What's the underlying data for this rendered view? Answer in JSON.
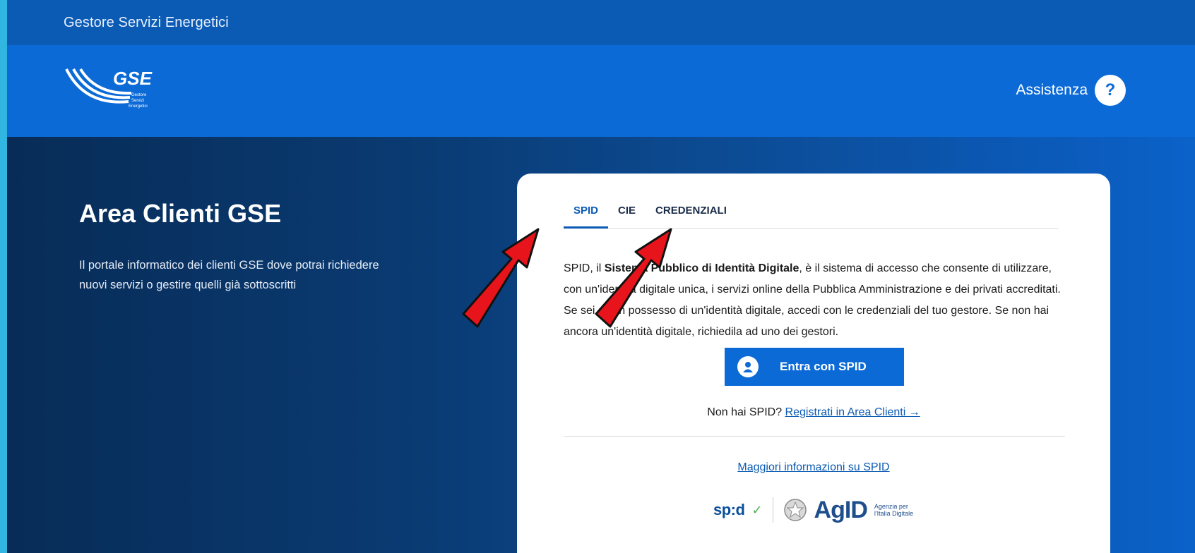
{
  "topbar": {
    "org_name": "Gestore Servizi Energetici"
  },
  "header": {
    "logo": {
      "wordmark": "GSE",
      "subtitle_1": "Gestore",
      "subtitle_2": "Servizi",
      "subtitle_3": "Energetici"
    },
    "assist_label": "Assistenza",
    "help_icon": "question-icon",
    "help_glyph": "?"
  },
  "hero": {
    "title": "Area Clienti GSE",
    "text": "Il portale informatico dei clienti GSE dove potrai richiedere nuovi servizi o gestire quelli già sottoscritti"
  },
  "login": {
    "tabs": [
      {
        "label": "SPID",
        "active": true
      },
      {
        "label": "CIE",
        "active": false
      },
      {
        "label": "CREDENZIALI",
        "active": false
      }
    ],
    "desc_1": "SPID, il ",
    "desc_bold": "Sistema Pubblico di Identità Digitale",
    "desc_2": ", è il sistema di accesso che consente di utilizzare, con un'identità digitale unica, i servizi online della Pubblica Amministrazione e dei privati accreditati. Se sei già in possesso di un'identità digitale, accedi con le credenziali del tuo gestore. Se non hai ancora un'identità digitale, richiedila ad uno dei gestori.",
    "spid_button": "Entra con SPID",
    "spid_button_icon": "user-icon",
    "no_spid_text": "Non hai SPID? ",
    "register_link": "Registrati in Area Clienti →",
    "more_info_link": "Maggiori informazioni su SPID",
    "logos": {
      "spid": "sp:d",
      "agid": "AgID",
      "agid_sub_1": "Agenzia per",
      "agid_sub_2": "l'Italia Digitale"
    }
  },
  "annotations": {
    "arrow_color": "#e8141b",
    "arrow_count": 2
  },
  "colors": {
    "primary": "#0b6ad6",
    "topbar": "#0b5ab3",
    "border_frame": "#31b6e2"
  }
}
